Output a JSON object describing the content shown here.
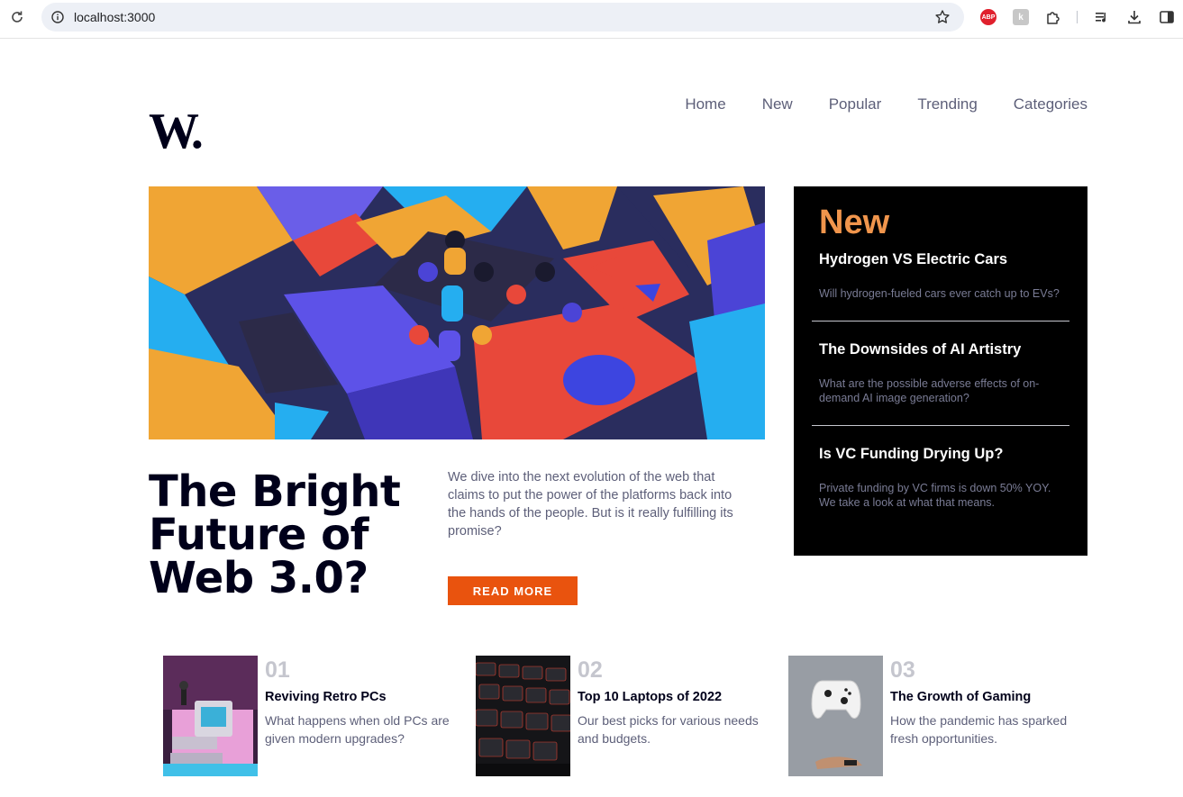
{
  "browser": {
    "url": "localhost:3000"
  },
  "site": {
    "logo": "W.",
    "nav": [
      "Home",
      "New",
      "Popular",
      "Trending",
      "Categories"
    ]
  },
  "hero": {
    "title": "The Bright Future of Web 3.0?",
    "description": "We dive into the next evolution of the web that claims to put the power of the platforms back into the hands of the people. But is it really fulfilling its promise?",
    "button_label": "READ MORE"
  },
  "new_panel": {
    "heading": "New",
    "items": [
      {
        "title": "Hydrogen VS Electric Cars",
        "text": "Will hydrogen-fueled cars ever catch up to EVs?"
      },
      {
        "title": "The Downsides of AI Artistry",
        "text": "What are the possible adverse effects of on-demand AI image generation?"
      },
      {
        "title": "Is VC Funding Drying Up?",
        "text": "Private funding by VC firms is down 50% YOY. We take a look at what that means."
      }
    ]
  },
  "cards": [
    {
      "num": "01",
      "title": "Reviving Retro PCs",
      "text": "What happens when old PCs are given modern upgrades?"
    },
    {
      "num": "02",
      "title": "Top 10 Laptops of 2022",
      "text": "Our best picks for various needs and budgets."
    },
    {
      "num": "03",
      "title": "The Growth of Gaming",
      "text": "How the pandemic has sparked fresh opportunities."
    }
  ],
  "colors": {
    "accent": "#e9530e",
    "new_heading": "#f0954c",
    "dark": "#00001a",
    "muted": "#5d5f79"
  }
}
